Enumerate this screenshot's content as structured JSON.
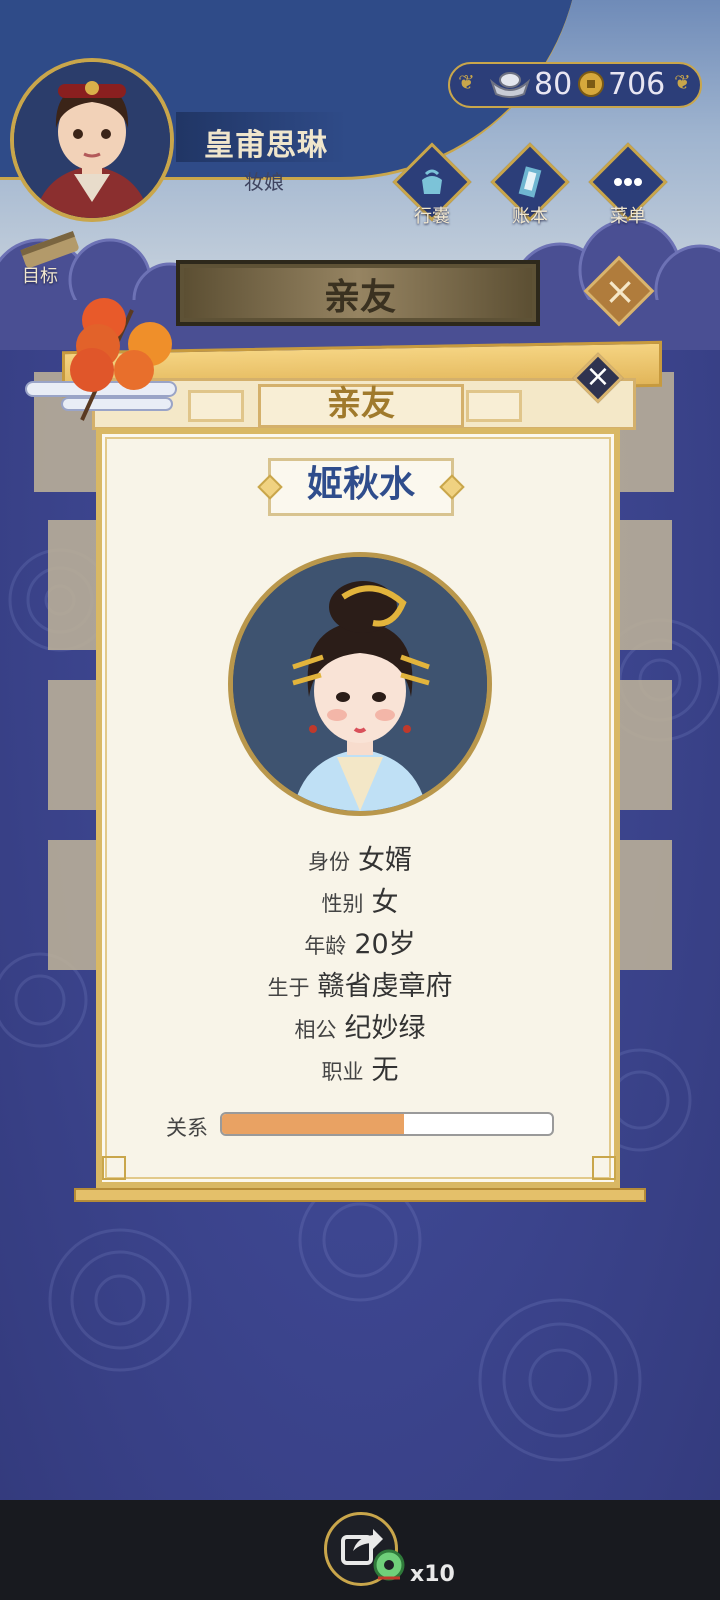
{
  "player": {
    "name": "皇甫思琳",
    "role": "妆娘"
  },
  "currency": {
    "ingot": "80",
    "coin": "706"
  },
  "top_buttons": {
    "bag": "行囊",
    "ledger": "账本",
    "menu": "菜单"
  },
  "goal_label": "目标",
  "background_title": "亲友",
  "dialog": {
    "header": "亲友",
    "name": "姬秋水",
    "rows": [
      {
        "key": "身份",
        "value": "女婿"
      },
      {
        "key": "性别",
        "value": "女"
      },
      {
        "key": "年龄",
        "value": "20岁"
      },
      {
        "key": "生于",
        "value": "赣省虔章府"
      },
      {
        "key": "相公",
        "value": "纪妙绿"
      },
      {
        "key": "职业",
        "value": "无"
      }
    ],
    "relation_label": "关系",
    "relation_level": 0.55
  },
  "share": {
    "count": "x10"
  },
  "colors": {
    "background": "#3a3f86",
    "gold": "#c9a64b",
    "name_blue": "#2f4d8c",
    "relation_fill": "#e9a263"
  }
}
